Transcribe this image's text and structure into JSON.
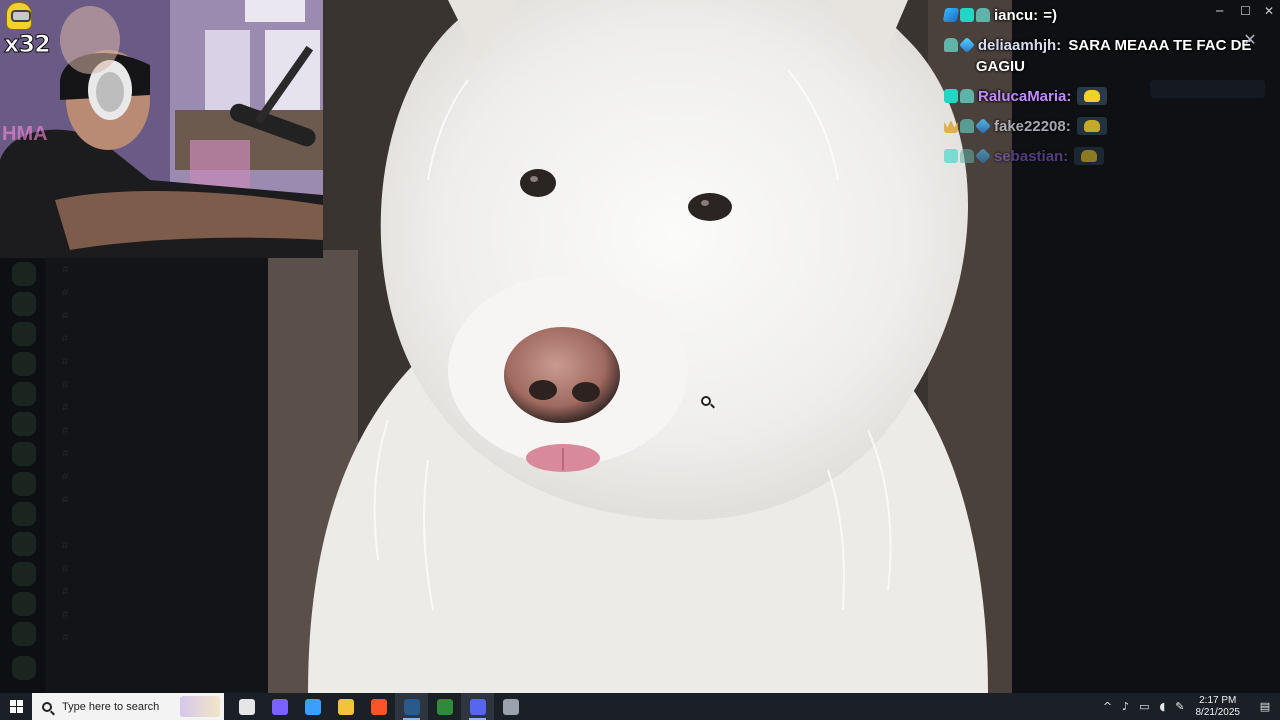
{
  "chat": {
    "messages": [
      {
        "user": "iancu:",
        "user_color": "#ffffff",
        "text": "=)",
        "badges": [
          "sword",
          "cyan",
          "robot"
        ],
        "emote": false
      },
      {
        "user": "deliaamhjh:",
        "user_color": "#d7ddef",
        "text": "SARA MEAAA TE FAC DE GAGIU",
        "badges": [
          "robot",
          "cube"
        ],
        "emote": false
      },
      {
        "user": "RalucaMaria:",
        "user_color": "#c28cff",
        "text": "",
        "badges": [
          "cyan",
          "robot"
        ],
        "emote": true
      },
      {
        "user": "fake22208:",
        "user_color": "#c9ced8",
        "text": "",
        "badges": [
          "crown",
          "robot",
          "cube"
        ],
        "emote": true
      },
      {
        "user": "sebastian:",
        "user_color": "#8a63d2",
        "text": "",
        "badges": [
          "cyan",
          "robot",
          "cube"
        ],
        "emote": true
      }
    ],
    "close_glyph": "✕"
  },
  "webcam": {
    "multiplier": "x32"
  },
  "sidebar": {
    "channels": [
      "",
      "",
      "",
      "",
      "",
      "",
      "",
      "",
      "",
      "",
      "",
      "",
      "",
      "",
      "",
      ""
    ]
  },
  "window": {
    "minimize_glyph": "─",
    "maximize_glyph": "☐",
    "close_glyph": "✕"
  },
  "taskbar": {
    "search_placeholder": "Type here to search",
    "apps": [
      {
        "name": "task-view",
        "color": "#e6e6e6",
        "active": false
      },
      {
        "name": "copilot",
        "color": "#7b61ff",
        "active": false
      },
      {
        "name": "microsoft-365",
        "color": "#3aa0ff",
        "active": false
      },
      {
        "name": "file-explorer",
        "color": "#f3c43b",
        "active": false
      },
      {
        "name": "brave",
        "color": "#fb542b",
        "active": false
      },
      {
        "name": "steam",
        "color": "#2a5a8a",
        "active": true
      },
      {
        "name": "xbox",
        "color": "#2f8a3a",
        "active": false
      },
      {
        "name": "discord",
        "color": "#5865f2",
        "active": true
      },
      {
        "name": "obs",
        "color": "#9aa3ad",
        "active": false
      }
    ],
    "time": "2:17 PM",
    "date": "8/21/2025"
  },
  "colors": {
    "taskbar": "#1b1f26",
    "background": "#0b0c0f",
    "accent": "#8ab4f8"
  }
}
